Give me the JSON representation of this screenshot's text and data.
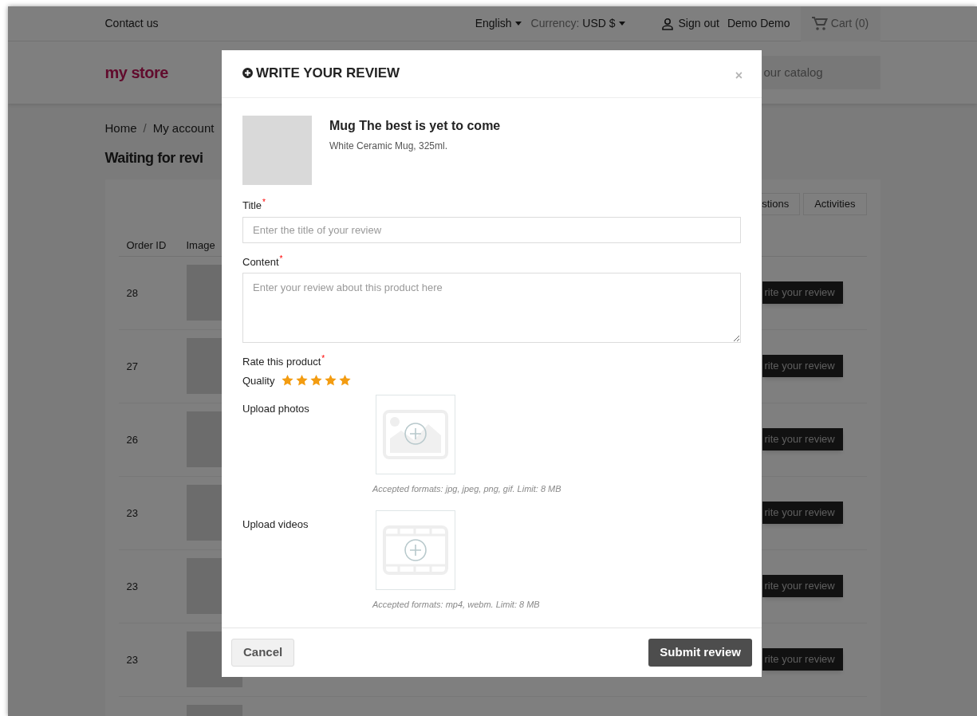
{
  "top_bar": {
    "contact": "Contact us",
    "language": "English",
    "currency_label": "Currency:",
    "currency_value": "USD $",
    "sign_out": "Sign out",
    "user": "Demo Demo",
    "cart": "Cart (0)"
  },
  "header": {
    "logo": "my store",
    "search_placeholder": "our catalog"
  },
  "breadcrumb": [
    "Home",
    "My account"
  ],
  "breadcrumb_separator": "/",
  "page_title": "Waiting for revi",
  "tabs": [
    {
      "label": "stions",
      "selected": false
    },
    {
      "label": "Activities",
      "selected": false
    }
  ],
  "table": {
    "columns": [
      "Order ID",
      "Image"
    ],
    "rows": [
      {
        "order_id": "28",
        "action": "rite your review"
      },
      {
        "order_id": "27",
        "action": "rite your review"
      },
      {
        "order_id": "26",
        "action": "rite your review"
      },
      {
        "order_id": "23",
        "action": "rite your review"
      },
      {
        "order_id": "23",
        "action": "rite your review"
      },
      {
        "order_id": "23",
        "action": "rite your review"
      }
    ]
  },
  "modal": {
    "title": "WRITE YOUR REVIEW",
    "close": "×",
    "product": {
      "name": "Mug The best is yet to come",
      "description": "White Ceramic Mug, 325ml."
    },
    "fields": [
      {
        "kind": "input",
        "label": "Title",
        "required_mark": "*",
        "placeholder": "Enter the title of your review"
      },
      {
        "kind": "textarea",
        "label": "Content",
        "required_mark": "*",
        "placeholder": "Enter your review about this product here"
      }
    ],
    "rating": {
      "label": "Rate this product",
      "required_mark": "*",
      "criteria": [
        {
          "label": "Quality",
          "stars": 5
        }
      ]
    },
    "uploads": [
      {
        "kind": "photo",
        "label": "Upload photos",
        "note": "Accepted formats: jpg, jpeg, png, gif. Limit: 8 MB"
      },
      {
        "kind": "video",
        "label": "Upload videos",
        "note": "Accepted formats: mp4, webm. Limit: 8 MB"
      }
    ],
    "buttons": {
      "cancel": "Cancel",
      "submit": "Submit review"
    }
  }
}
